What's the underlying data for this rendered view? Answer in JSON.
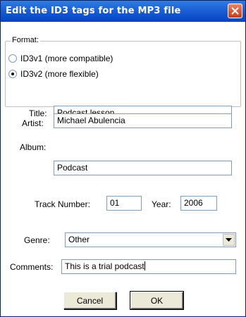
{
  "window": {
    "title": "Edit the ID3 tags for the MP3 file"
  },
  "format": {
    "group_label": "Format:",
    "options": [
      {
        "label": "ID3v1 (more compatible)",
        "selected": false
      },
      {
        "label": "ID3v2 (more flexible)",
        "selected": true
      }
    ]
  },
  "fields": {
    "title": {
      "label": "Title:",
      "value": "Podcast lesson"
    },
    "artist": {
      "label": "Artist:",
      "value": "Michael Abulencia"
    },
    "album": {
      "label": "Album:",
      "value": "Podcast"
    },
    "track_number": {
      "label": "Track Number:",
      "value": "01"
    },
    "year": {
      "label": "Year:",
      "value": "2006"
    },
    "genre": {
      "label": "Genre:",
      "value": "Other"
    },
    "comments": {
      "label": "Comments:",
      "value": "This is a trial podcast"
    }
  },
  "buttons": {
    "cancel": "Cancel",
    "ok": "OK"
  },
  "icons": {
    "close": "close-icon",
    "dropdown": "chevron-down-icon"
  },
  "colors": {
    "titlebar": "#0b4dc9",
    "close_button": "#d85a36"
  }
}
